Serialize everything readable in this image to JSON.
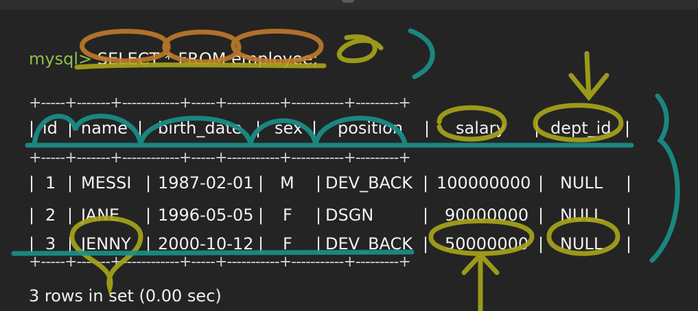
{
  "prompt": {
    "label": "mysql>",
    "command": "SELECT * FROM employee;"
  },
  "table": {
    "border": "+-----+-------+------------+-----+-----------+-----------+---------+",
    "headers": [
      "id",
      "name",
      "birth_date",
      "sex",
      "position",
      "salary",
      "dept_id"
    ],
    "rows": [
      [
        "1",
        "MESSI",
        "1987-02-01",
        "M",
        "DEV_BACK",
        "100000000",
        "NULL"
      ],
      [
        "2",
        "JANE",
        "1996-05-05",
        "F",
        "DSGN",
        "90000000",
        "NULL"
      ],
      [
        "3",
        "JENNY",
        "2000-10-12",
        "F",
        "DEV_BACK",
        "50000000",
        "NULL"
      ]
    ]
  },
  "status": "3 rows in set (0.00 sec)",
  "colors": {
    "background": "#242424",
    "prompt": "#8cc04a",
    "annotation_orange": "#c07a2a",
    "annotation_yellow": "#a8a61a",
    "annotation_teal": "#1a8f88"
  }
}
